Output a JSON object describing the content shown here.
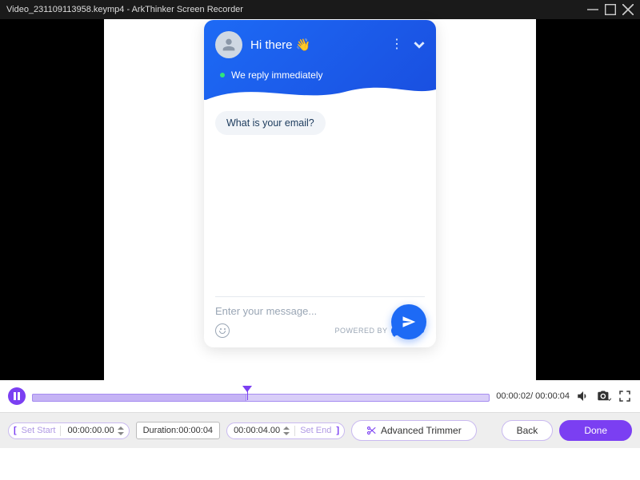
{
  "titlebar": {
    "filename": "Video_231109113958.keymp4",
    "sep": " - ",
    "app": "ArkThinker Screen Recorder"
  },
  "chat": {
    "greeting": "Hi there",
    "wave_emoji": "👋",
    "reply_status": "We reply immediately",
    "question": "What is your email?",
    "input_placeholder": "Enter your message...",
    "powered_prefix": "POWERED BY",
    "powered_brand": "TIDIO"
  },
  "timeline": {
    "time_text": "00:00:02/ 00:00:04"
  },
  "controls": {
    "set_start": "Set Start",
    "start_time": "00:00:00.00",
    "duration_label": "Duration:",
    "duration_value": "00:00:04",
    "end_time": "00:00:04.00",
    "set_end": "Set End",
    "advanced_trimmer": "Advanced Trimmer",
    "back": "Back",
    "done": "Done"
  }
}
